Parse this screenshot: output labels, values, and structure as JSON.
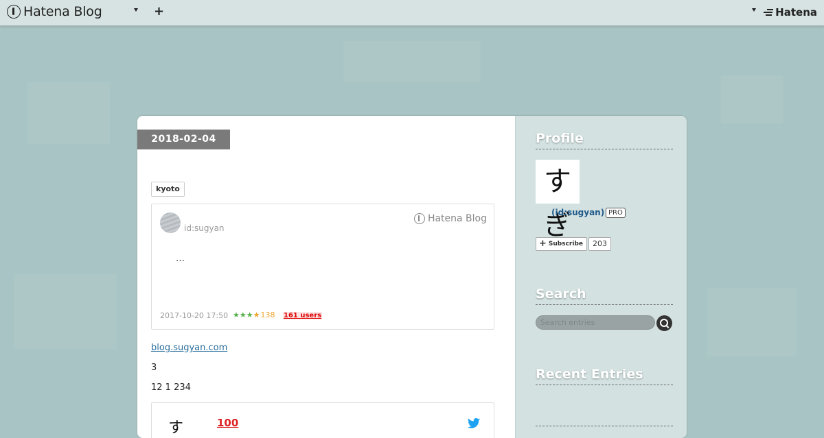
{
  "topbar": {
    "brand": "Hatena Blog",
    "add_label": "+",
    "right_brand": "Hatena"
  },
  "entry": {
    "date": "2018-02-04",
    "tag": "kyoto",
    "embed": {
      "user": "id:sugyan",
      "logo_text": "Hatena Blog",
      "excerpt": "…",
      "date": "2017-10-20 17:50",
      "star_count": "138",
      "users": "161 users"
    },
    "link": "blog.sugyan.com",
    "para1": "3",
    "para2": "12 1 234",
    "tweet": {
      "emoji_text": "100"
    }
  },
  "sidebar": {
    "profile_title": "Profile",
    "profile_char": "すぎ",
    "profile_id": "(id:sugyan)",
    "pro": "PRO",
    "subscribe": "Subscribe",
    "subscribers": "203",
    "search_title": "Search",
    "search_placeholder": "Search entries",
    "recent_title": "Recent Entries"
  },
  "colors": {
    "background": "#a9c4c4",
    "topbar": "#d7e3e3",
    "date_box": "#7a7a7a",
    "link": "#2a6d9c",
    "users_badge": "#dd0000",
    "sidebar": "#d3e1e1"
  }
}
